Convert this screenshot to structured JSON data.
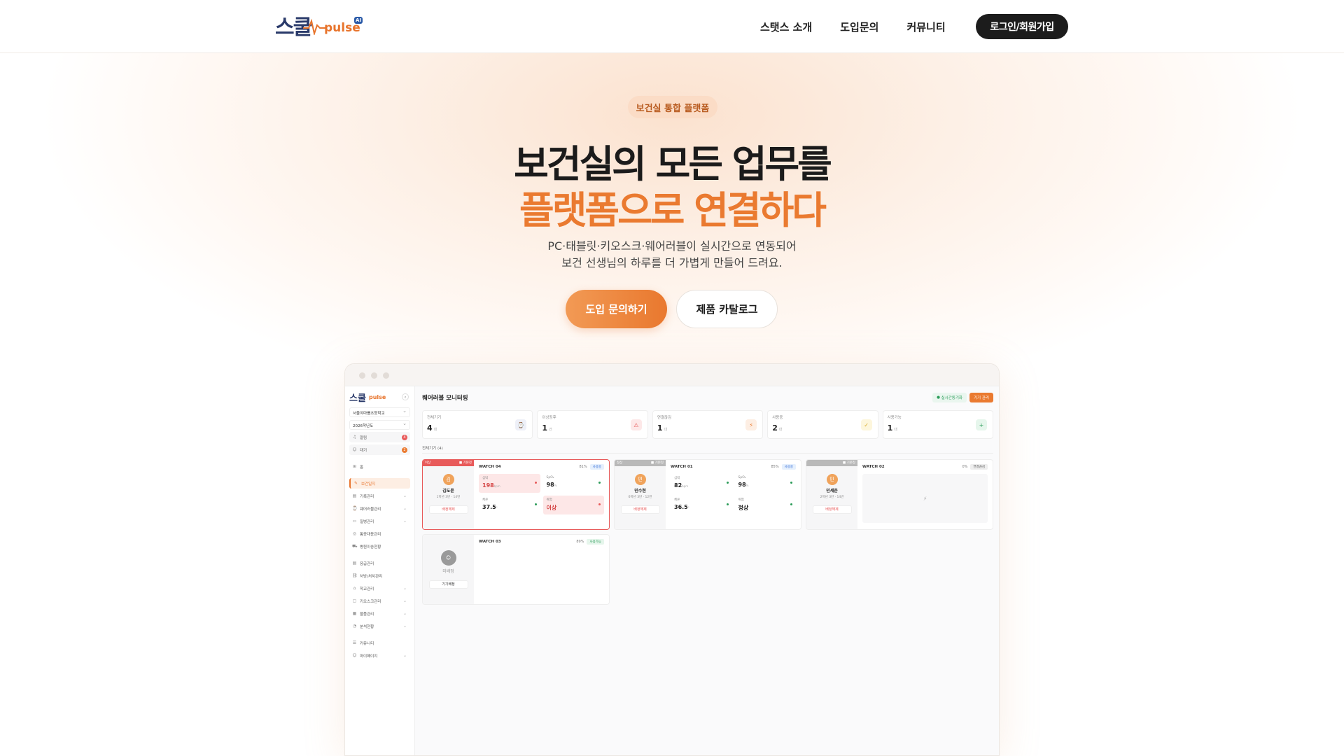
{
  "header": {
    "logo_text": "스쿨",
    "logo_pulse": "pulse",
    "logo_ai": "AI",
    "nav": [
      "스탯스 소개",
      "도입문의",
      "커뮤니티"
    ],
    "login_label": "로그인/회원가입"
  },
  "hero": {
    "badge": "보건실 통합 플랫폼",
    "title_line1": "보건실의 모든 업무를",
    "title_line2": "플랫폼으로 연결하다",
    "subtitle_line1": "PC·태블릿·키오스크·웨어러블이 실시간으로 연동되어",
    "subtitle_line2": "보건 선생님의 하루를 더 가볍게 만들어 드려요.",
    "cta_primary": "도입 문의하기",
    "cta_secondary": "제품 카탈로그",
    "accent_color": "#ea7a30"
  },
  "dashboard": {
    "sidebar": {
      "logo": "스쿨",
      "logo_pulse": "pulse",
      "school_select": "서울야마를초등학교",
      "year_select": "2026학년도",
      "alerts": [
        {
          "label": "알림",
          "count": "4",
          "color": "#e85a5a"
        },
        {
          "label": "대기",
          "count": "2",
          "color": "#ea7a30"
        }
      ],
      "home": "홈",
      "items": [
        {
          "label": "보건일지",
          "icon": "edit-icon",
          "active": true
        },
        {
          "label": "기록관리",
          "icon": "doc-icon",
          "chev": true
        },
        {
          "label": "웨어러블관리",
          "icon": "watch-icon",
          "chev": true
        },
        {
          "label": "질병관리",
          "icon": "card-icon",
          "chev": true
        },
        {
          "label": "통증대응관리",
          "icon": "globe-icon"
        },
        {
          "label": "병원이송현황",
          "icon": "car-icon"
        }
      ],
      "items2": [
        {
          "label": "응급관리",
          "icon": "doc-icon"
        },
        {
          "label": "처방/처치관리",
          "icon": "link-icon"
        },
        {
          "label": "학교관리",
          "icon": "school-icon",
          "chev": true
        },
        {
          "label": "키오스크관리",
          "icon": "monitor-icon",
          "chev": true
        },
        {
          "label": "물품관리",
          "icon": "box-icon",
          "chev": true
        },
        {
          "label": "분석현황",
          "icon": "chart-icon",
          "chev": true
        }
      ],
      "items3": [
        {
          "label": "커뮤니티",
          "icon": "chat-icon"
        },
        {
          "label": "마이페이지",
          "icon": "user-icon",
          "chev": true
        }
      ]
    },
    "title": "웨어러블 모니터링",
    "btn_realtime": "실시간동기화",
    "btn_manage": "기기 관리",
    "stats": [
      {
        "label": "전체기기",
        "value": "4",
        "unit": "대",
        "icon": "watch-icon",
        "color": "#6b7ab8",
        "bg": "#eef0f8"
      },
      {
        "label": "이상징후",
        "value": "1",
        "unit": "건",
        "icon": "alarm-icon",
        "color": "#e85a5a",
        "bg": "#fde8e8"
      },
      {
        "label": "연결끊김",
        "value": "1",
        "unit": "대",
        "icon": "signal-off-icon",
        "color": "#ea7a30",
        "bg": "#fdeee3"
      },
      {
        "label": "사용중",
        "value": "2",
        "unit": "대",
        "icon": "check-icon",
        "color": "#d6a823",
        "bg": "#fdf6dc"
      },
      {
        "label": "사용가능",
        "value": "1",
        "unit": "대",
        "icon": "plus-icon",
        "color": "#2c9c5a",
        "bg": "#e6f6ec"
      }
    ],
    "section_label": "전체기기 (4)",
    "cards": [
      {
        "tag_left": "이상",
        "tag_right": "■ 기본정",
        "tag_color": "#e85a5a",
        "avatar": "김",
        "avatar_color": "#f0a35b",
        "name": "김도윤",
        "sub": "1학년 3반 · 14번",
        "button": "배정해제",
        "device": "WATCH 04",
        "battery": "81%",
        "status": "사용중",
        "status_class": "blue",
        "metrics": [
          {
            "label": "심박",
            "value": "198",
            "unit": "bpm",
            "bad": true,
            "dot": "#e85a5a"
          },
          {
            "label": "SpO₂",
            "value": "98",
            "unit": "%",
            "bad": false,
            "dot": "#2c9c5a"
          },
          {
            "label": "체온",
            "value": "37.5",
            "unit": "°",
            "bad": false,
            "dot": "#2c9c5a"
          },
          {
            "label": "위험",
            "value": "이상",
            "unit": "",
            "bad": true,
            "dot": "#e85a5a"
          }
        ],
        "danger": true
      },
      {
        "tag_left": "정상",
        "tag_right": "■ 기본정",
        "tag_color": "#b9b9b9",
        "avatar": "민",
        "avatar_color": "#f0a35b",
        "name": "민수현",
        "sub": "6학년 3반 · 12번",
        "button": "배정해제",
        "device": "WATCH 01",
        "battery": "85%",
        "status": "사용중",
        "status_class": "blue",
        "metrics": [
          {
            "label": "심박",
            "value": "82",
            "unit": "bpm",
            "bad": false,
            "dot": "#2c9c5a"
          },
          {
            "label": "SpO₂",
            "value": "98",
            "unit": "%",
            "bad": false,
            "dot": "#2c9c5a"
          },
          {
            "label": "체온",
            "value": "36.5",
            "unit": "°",
            "bad": false,
            "dot": "#2c9c5a"
          },
          {
            "label": "위험",
            "value": "정상",
            "unit": "",
            "bad": false,
            "dot": "#2c9c5a"
          }
        ],
        "danger": false
      },
      {
        "tag_left": "",
        "tag_right": "■ 기본정",
        "tag_color": "#b9b9b9",
        "avatar": "민",
        "avatar_color": "#f0a35b",
        "name": "민세준",
        "sub": "2학년 3반 · 14번",
        "button": "배정해제",
        "device": "WATCH 02",
        "battery": "0%",
        "status": "연결끊김",
        "status_class": "gray",
        "danger": false,
        "empty": true
      },
      {
        "tag_left": "",
        "tag_right": "",
        "tag_color": "#f6f6f7",
        "avatar": "",
        "avatar_color": "#9a9a9a",
        "name": "미배정",
        "sub": "",
        "button": "기기배정",
        "device": "WATCH 03",
        "battery": "89%",
        "status": "사용가능",
        "status_class": "green",
        "danger": false,
        "unassigned": true
      }
    ]
  }
}
